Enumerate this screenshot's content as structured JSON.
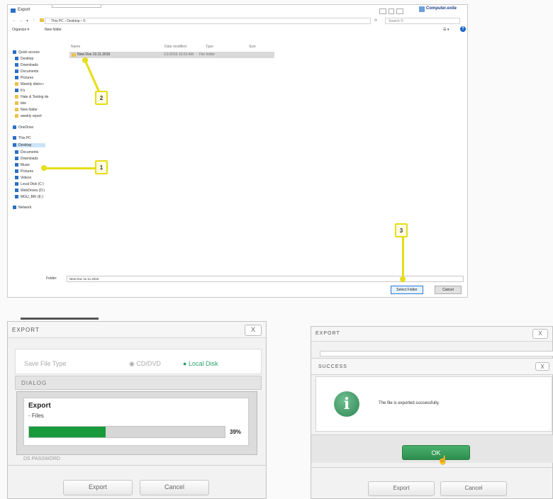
{
  "explorer": {
    "title": "Export",
    "user": "Computer.exile",
    "path": "This PC › Desktop › ©",
    "search": "Search ©",
    "toolbar": {
      "organize": "Organize ▾",
      "new_folder": "New folder"
    },
    "columns": {
      "name": "Name",
      "date": "Date modified",
      "type": "Type",
      "size": "Size"
    },
    "sidebar": [
      "Quick access",
      "Desktop",
      "Downloads",
      "Documents",
      "Pictures",
      "Weekly distro r",
      "It's",
      "Hate & Testing de",
      "tele",
      "New folder",
      "weekly report",
      "OneDrive",
      "This PC",
      "Desktop",
      "Documents",
      "Downloads",
      "Music",
      "Pictures",
      "Videos",
      "Local Disk (C:)",
      "WebDrives (D:)",
      "MGU_BKI (E:)",
      "Network"
    ],
    "file": {
      "name": "New Dos 10.11.2016",
      "date": "1/1/2016 10:53 AM",
      "type": "File folder"
    },
    "filename_label": "Folder:",
    "filename_value": "New Doc 11.11.2016",
    "select_button": "Select Folder",
    "cancel_button": "Cancel",
    "callouts": [
      "1",
      "2",
      "3"
    ]
  },
  "export_progress": {
    "header": "EXPORT",
    "close": "X",
    "save_file_type_label": "Save File Type",
    "option_cd": "CD/DVD",
    "option_local": "Local Disk",
    "dialog_header": "DIALOG",
    "progress_title": "Export",
    "progress_subtitle": "- Files",
    "progress_percent": "39%",
    "progress_value": 0.39,
    "behind_text": "DS PASSWORD",
    "export_button": "Export",
    "cancel_button": "Cancel"
  },
  "export_success": {
    "header": "EXPORT",
    "close": "X",
    "success_header": "SUCCESS",
    "message": "The file is exported successfully.",
    "ok_button": "OK",
    "export_button": "Export",
    "cancel_button": "Cancel"
  },
  "colors": {
    "progress_green": "#169a3c",
    "ok_green": "#2f9a52",
    "info_green": "#3a8f5e",
    "callout_yellow": "#e6dd18"
  }
}
